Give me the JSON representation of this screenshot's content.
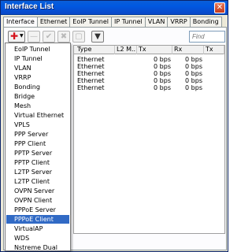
{
  "window": {
    "title": "Interface List",
    "close_label": "✕"
  },
  "tabs": [
    {
      "label": "Interface",
      "active": true
    },
    {
      "label": "Ethernet",
      "active": false
    },
    {
      "label": "EoIP Tunnel",
      "active": false
    },
    {
      "label": "IP Tunnel",
      "active": false
    },
    {
      "label": "VLAN",
      "active": false
    },
    {
      "label": "VRRP",
      "active": false
    },
    {
      "label": "Bonding",
      "active": false
    }
  ],
  "toolbar": {
    "add_icon": "plus-icon",
    "add_glyph": "✚",
    "dropdown_glyph": "▼",
    "remove_glyph": "—",
    "enable_glyph": "✔",
    "disable_glyph": "✖",
    "comment_glyph": "▢",
    "filter_glyph": "▼",
    "find_placeholder": "Find"
  },
  "table": {
    "columns": [
      "Type",
      "L2 M...",
      "Tx",
      "Rx",
      "Tx"
    ],
    "rows": [
      {
        "type": "Ethernet",
        "l2mtu": "",
        "tx": "0 bps",
        "rx": "0 bps"
      },
      {
        "type": "Ethernet",
        "l2mtu": "",
        "tx": "0 bps",
        "rx": "0 bps"
      },
      {
        "type": "Ethernet",
        "l2mtu": "",
        "tx": "0 bps",
        "rx": "0 bps"
      },
      {
        "type": "Ethernet",
        "l2mtu": "",
        "tx": "0 bps",
        "rx": "0 bps"
      },
      {
        "type": "Ethernet",
        "l2mtu": "",
        "tx": "0 bps",
        "rx": "0 bps"
      }
    ]
  },
  "menu": {
    "items": [
      "EoIP Tunnel",
      "IP Tunnel",
      "VLAN",
      "VRRP",
      "Bonding",
      "Bridge",
      "Mesh",
      "Virtual Ethernet",
      "VPLS",
      "PPP Server",
      "PPP Client",
      "PPTP Server",
      "PPTP Client",
      "L2TP Server",
      "L2TP Client",
      "OVPN Server",
      "OVPN Client",
      "PPPoE Server",
      "PPPoE Client",
      "VirtualAP",
      "WDS",
      "Nstreme Dual"
    ],
    "selected": "PPPoE Client"
  },
  "colors": {
    "titlebar": "#0058e0",
    "selection": "#316ac5",
    "add_icon": "#d4141c"
  }
}
